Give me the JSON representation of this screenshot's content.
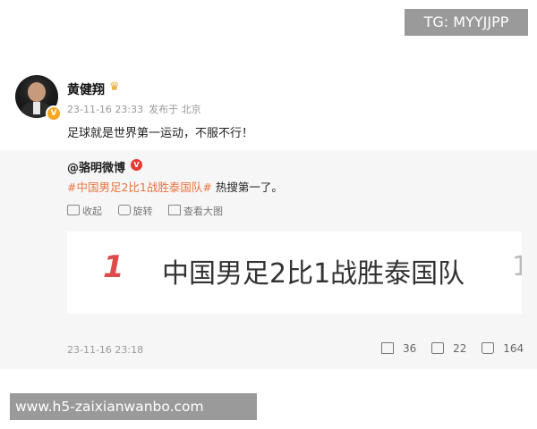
{
  "watermark_top": "TG: MYYJJPP",
  "post": {
    "username": "黄健翔",
    "username_badge_icon": "crown-icon",
    "timestamp": "23-11-16 23:33",
    "source": "发布于 北京",
    "text": "足球就是世界第一运动，不服不行！"
  },
  "repost": {
    "author": "@骆明微博",
    "hashtag": "#中国男足2比1战胜泰国队#",
    "text_suffix": " 热搜第一了。",
    "actions": [
      {
        "icon": "bookmark-icon",
        "label": "收起"
      },
      {
        "icon": "rotate-icon",
        "label": "旋转"
      },
      {
        "icon": "view-large-icon",
        "label": "查看大图"
      }
    ],
    "card": {
      "rank": "1",
      "title": "中国男足2比1战胜泰国队",
      "cut_off": "1"
    },
    "timestamp": "23-11-16 23:18",
    "stats": {
      "reposts": "36",
      "comments": "22",
      "likes": "164"
    }
  },
  "watermark_bottom": "www.h5-zaixianwanbo.com",
  "colors": {
    "accent": "#eb7340",
    "rank_red": "#e04a4a",
    "verified": "#f5a623",
    "background": "#f6f6f6"
  }
}
